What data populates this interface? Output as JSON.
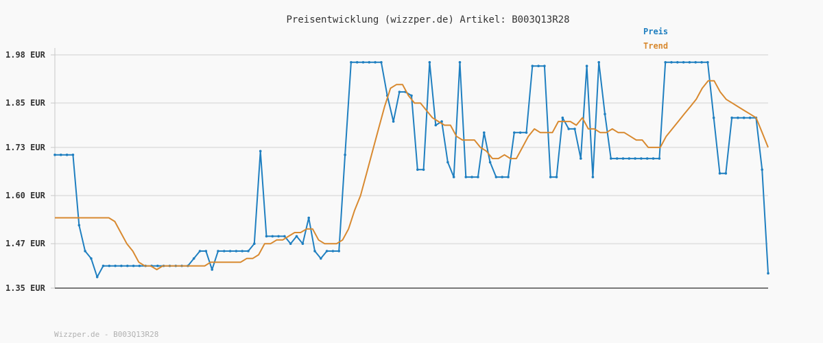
{
  "chart_data": {
    "type": "line",
    "title": "Preisentwicklung (wizzper.de) Artikel: B003Q13R28",
    "footer": "Wizzper.de - B003Q13R28",
    "y_tick_labels": [
      "1.98 EUR",
      "1.85 EUR",
      "1.73 EUR",
      "1.60 EUR",
      "1.47 EUR",
      "1.35 EUR"
    ],
    "ylim": [
      1.35,
      1.98
    ],
    "grid": true,
    "legend_position": "top-right",
    "series": [
      {
        "name": "Preis",
        "color": "#1f7fc0",
        "values": [
          1.71,
          1.71,
          1.71,
          1.71,
          1.52,
          1.45,
          1.43,
          1.38,
          1.41,
          1.41,
          1.41,
          1.41,
          1.41,
          1.41,
          1.41,
          1.41,
          1.41,
          1.41,
          1.41,
          1.41,
          1.41,
          1.41,
          1.41,
          1.43,
          1.45,
          1.45,
          1.4,
          1.45,
          1.45,
          1.45,
          1.45,
          1.45,
          1.45,
          1.47,
          1.72,
          1.49,
          1.49,
          1.49,
          1.49,
          1.47,
          1.49,
          1.47,
          1.54,
          1.45,
          1.43,
          1.45,
          1.45,
          1.45,
          1.71,
          1.96,
          1.96,
          1.96,
          1.96,
          1.96,
          1.96,
          1.87,
          1.8,
          1.88,
          1.88,
          1.87,
          1.67,
          1.67,
          1.96,
          1.79,
          1.8,
          1.69,
          1.65,
          1.96,
          1.65,
          1.65,
          1.65,
          1.77,
          1.69,
          1.65,
          1.65,
          1.65,
          1.77,
          1.77,
          1.77,
          1.95,
          1.95,
          1.95,
          1.65,
          1.65,
          1.81,
          1.78,
          1.78,
          1.7,
          1.95,
          1.65,
          1.96,
          1.82,
          1.7,
          1.7,
          1.7,
          1.7,
          1.7,
          1.7,
          1.7,
          1.7,
          1.7,
          1.96,
          1.96,
          1.96,
          1.96,
          1.96,
          1.96,
          1.96,
          1.96,
          1.81,
          1.66,
          1.66,
          1.81,
          1.81,
          1.81,
          1.81,
          1.81,
          1.67,
          1.39
        ]
      },
      {
        "name": "Trend",
        "color": "#d8892f",
        "values": [
          1.54,
          1.54,
          1.54,
          1.54,
          1.54,
          1.54,
          1.54,
          1.54,
          1.54,
          1.54,
          1.53,
          1.5,
          1.47,
          1.45,
          1.42,
          1.41,
          1.41,
          1.4,
          1.41,
          1.41,
          1.41,
          1.41,
          1.41,
          1.41,
          1.41,
          1.41,
          1.42,
          1.42,
          1.42,
          1.42,
          1.42,
          1.42,
          1.43,
          1.43,
          1.44,
          1.47,
          1.47,
          1.48,
          1.48,
          1.49,
          1.5,
          1.5,
          1.51,
          1.51,
          1.48,
          1.47,
          1.47,
          1.47,
          1.48,
          1.51,
          1.56,
          1.6,
          1.66,
          1.72,
          1.78,
          1.84,
          1.89,
          1.9,
          1.9,
          1.87,
          1.85,
          1.85,
          1.83,
          1.81,
          1.8,
          1.79,
          1.79,
          1.76,
          1.75,
          1.75,
          1.75,
          1.73,
          1.72,
          1.7,
          1.7,
          1.71,
          1.7,
          1.7,
          1.73,
          1.76,
          1.78,
          1.77,
          1.77,
          1.77,
          1.8,
          1.8,
          1.8,
          1.79,
          1.81,
          1.78,
          1.78,
          1.77,
          1.77,
          1.78,
          1.77,
          1.77,
          1.76,
          1.75,
          1.75,
          1.73,
          1.73,
          1.73,
          1.76,
          1.78,
          1.8,
          1.82,
          1.84,
          1.86,
          1.89,
          1.91,
          1.91,
          1.88,
          1.86,
          1.85,
          1.84,
          1.83,
          1.82,
          1.81,
          1.77,
          1.73
        ]
      }
    ]
  }
}
